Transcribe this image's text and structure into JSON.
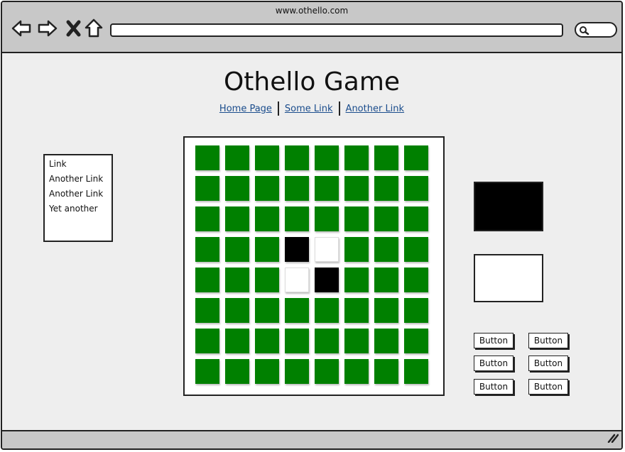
{
  "browser": {
    "url": "www.othello.com",
    "nav_icons": [
      "back-arrow-icon",
      "forward-arrow-icon",
      "stop-icon",
      "home-icon"
    ],
    "search_icon": "search-icon"
  },
  "page": {
    "title": "Othello Game",
    "top_links": [
      "Home Page",
      "Some Link",
      "Another Link"
    ]
  },
  "sidebar": {
    "items": [
      "Link",
      "Another Link",
      "Another Link",
      "Yet another"
    ]
  },
  "board": {
    "size": 8,
    "colors": {
      "green": "#008000",
      "black": "#000000",
      "white": "#ffffff"
    },
    "cells": [
      [
        "g",
        "g",
        "g",
        "g",
        "g",
        "g",
        "g",
        "g"
      ],
      [
        "g",
        "g",
        "g",
        "g",
        "g",
        "g",
        "g",
        "g"
      ],
      [
        "g",
        "g",
        "g",
        "g",
        "g",
        "g",
        "g",
        "g"
      ],
      [
        "g",
        "g",
        "g",
        "b",
        "w",
        "g",
        "g",
        "g"
      ],
      [
        "g",
        "g",
        "g",
        "w",
        "b",
        "g",
        "g",
        "g"
      ],
      [
        "g",
        "g",
        "g",
        "g",
        "g",
        "g",
        "g",
        "g"
      ],
      [
        "g",
        "g",
        "g",
        "g",
        "g",
        "g",
        "g",
        "g"
      ],
      [
        "g",
        "g",
        "g",
        "g",
        "g",
        "g",
        "g",
        "g"
      ]
    ]
  },
  "players": {
    "black_swatch": "#000000",
    "white_swatch": "#ffffff"
  },
  "buttons": [
    "Button",
    "Button",
    "Button",
    "Button",
    "Button",
    "Button"
  ]
}
